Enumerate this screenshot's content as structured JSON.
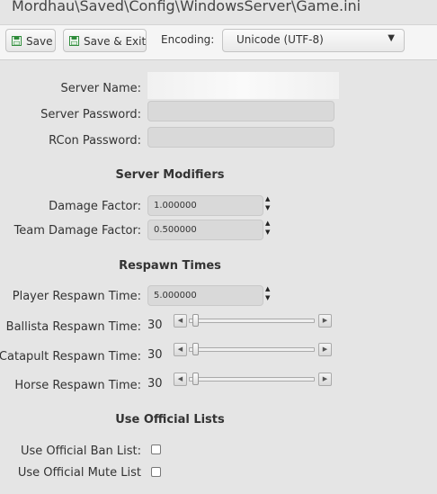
{
  "window": {
    "title": "Mordhau\\Saved\\Config\\WindowsServer\\Game.ini"
  },
  "toolbar": {
    "save_label": "Save",
    "save_exit_label": "Save & Exit",
    "encoding_label": "Encoding:",
    "encoding_value": "Unicode (UTF-8)",
    "save_icon": "floppy-disk-icon",
    "accent": "#2e8b3a"
  },
  "server": {
    "name_label": "Server Name:",
    "password_label": "Server Password:",
    "rcon_label": "RCon Password:",
    "password_value": "",
    "rcon_value": ""
  },
  "modifiers": {
    "heading": "Server Modifiers",
    "damage_label": "Damage Factor:",
    "damage_value": "1.000000",
    "team_damage_label": "Team Damage Factor:",
    "team_damage_value": "0.500000"
  },
  "respawn": {
    "heading": "Respawn Times",
    "player_label": "Player Respawn Time:",
    "player_value": "5.000000",
    "ballista_label": "Ballista Respawn Time:",
    "ballista_value": "30",
    "catapult_label": "Catapult Respawn Time:",
    "catapult_value": "30",
    "horse_label": "Horse Respawn Time:",
    "horse_value": "30"
  },
  "lists": {
    "heading": "Use Official Lists",
    "ban_label": "Use Official Ban List:",
    "mute_label": "Use Official Mute List",
    "ban_checked": false,
    "mute_checked": false
  }
}
